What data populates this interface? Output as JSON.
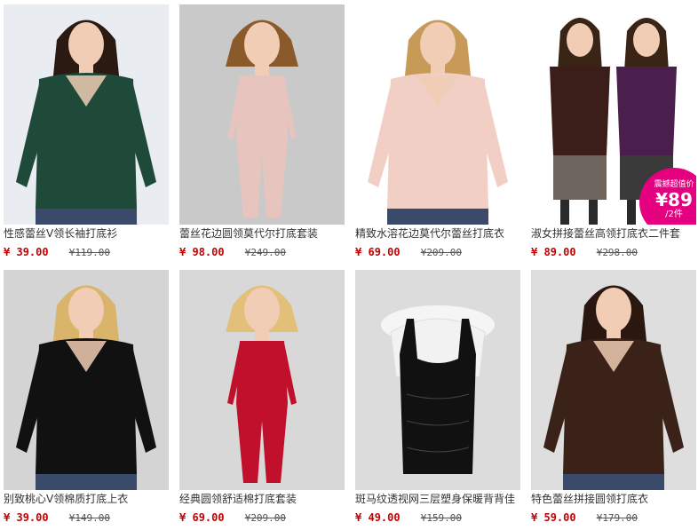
{
  "currency": "¥",
  "products": [
    {
      "title": "性感蕾丝V领长袖打底衫",
      "price": "39.00",
      "original_price": "119.00"
    },
    {
      "title": "蕾丝花边圆领莫代尔打底套装",
      "price": "98.00",
      "original_price": "249.00"
    },
    {
      "title": "精致水溶花边莫代尔蕾丝打底衣",
      "price": "69.00",
      "original_price": "209.00"
    },
    {
      "title": "淑女拼接蕾丝高领打底衣二件套",
      "price": "89.00",
      "original_price": "298.00",
      "badge": {
        "line1": "震撼超值价",
        "line2": "¥89",
        "line3": "/2件"
      }
    },
    {
      "title": "别致桃心V领棉质打底上衣",
      "price": "39.00",
      "original_price": "149.00"
    },
    {
      "title": "经典圆领舒适棉打底套装",
      "price": "69.00",
      "original_price": "209.00"
    },
    {
      "title": "斑马纹透视网三层塑身保暖背背佳",
      "price": "49.00",
      "original_price": "159.00"
    },
    {
      "title": "特色蕾丝拼接圆领打底衣",
      "price": "59.00",
      "original_price": "179.00"
    }
  ],
  "colors": {
    "price": "#c40000",
    "badge": "#e4007f",
    "garment_green": "#1f4a3a",
    "garment_pink": "#e8c4bf",
    "garment_peach": "#f2cfc4",
    "garment_plum": "#4a1f4e",
    "garment_black": "#111111",
    "garment_red": "#c0102c",
    "garment_brown": "#3a2218"
  },
  "icons": {
    "photo": "product-photo-icon"
  }
}
